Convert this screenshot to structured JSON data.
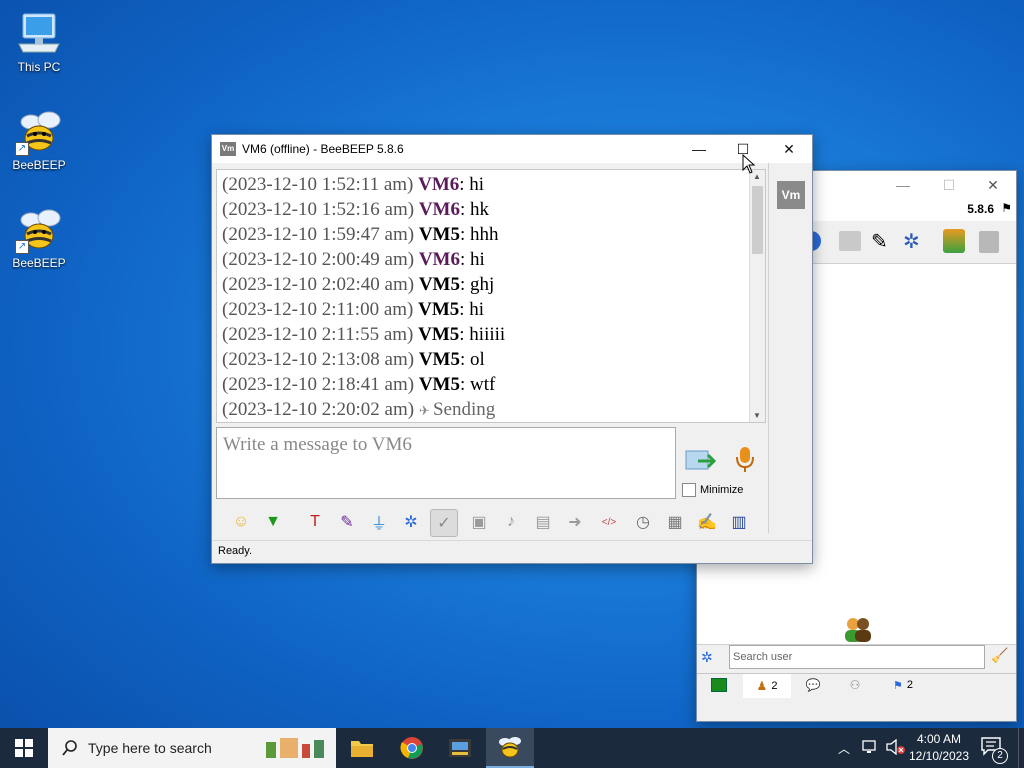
{
  "desktop": {
    "icons": [
      {
        "label": "This PC"
      },
      {
        "label": "BeeBEEP"
      },
      {
        "label": "BeeBEEP"
      }
    ]
  },
  "chat_window": {
    "icon_text": "Vm",
    "title": "VM6 (offline) - BeeBEEP 5.8.6",
    "messages": [
      {
        "ts": "(2023-12-10 1:52:11 am)",
        "user": "VM6",
        "text": ": hi"
      },
      {
        "ts": "(2023-12-10 1:52:16 am)",
        "user": "VM6",
        "text": ": hk"
      },
      {
        "ts": "(2023-12-10 1:59:47 am)",
        "user": "VM5",
        "text": ": hhh"
      },
      {
        "ts": "(2023-12-10 2:00:49 am)",
        "user": "VM6",
        "text": ": hi"
      },
      {
        "ts": "(2023-12-10 2:02:40 am)",
        "user": "VM5",
        "text": ": ghj"
      },
      {
        "ts": "(2023-12-10 2:11:00 am)",
        "user": "VM5",
        "text": ": hi"
      },
      {
        "ts": "(2023-12-10 2:11:55 am)",
        "user": "VM5",
        "text": ": hiiiii"
      },
      {
        "ts": "(2023-12-10 2:13:08 am)",
        "user": "VM5",
        "text": ": ol"
      },
      {
        "ts": "(2023-12-10 2:18:41 am)",
        "user": "VM5",
        "text": ": wtf"
      },
      {
        "ts": "(2023-12-10 2:20:02 am)",
        "status": "Sending"
      }
    ],
    "input_placeholder": "Write a message to VM6",
    "minimize_label": "Minimize",
    "side_avatar": "Vm",
    "status": "Ready.",
    "toolbar_icons": [
      "smiley-icon",
      "green-down-icon",
      "font-icon",
      "color-icon",
      "filter-icon",
      "gear-icon",
      "spellcheck-icon",
      "dictionary-icon",
      "music-icon",
      "file-icon",
      "send-file-icon",
      "html-icon",
      "clock-icon",
      "screenshot-icon",
      "notes-icon",
      "save-icon"
    ]
  },
  "back_window": {
    "version": "5.8.6",
    "search_placeholder": "Search user",
    "tabs": [
      {
        "icon": "green-screen-icon",
        "count": ""
      },
      {
        "icon": "users-icon",
        "count": "2"
      },
      {
        "icon": "chat-icon",
        "count": ""
      },
      {
        "icon": "groups-icon",
        "count": ""
      },
      {
        "icon": "flag-icon",
        "count": "2"
      }
    ]
  },
  "taskbar": {
    "search_text": "Type here to search",
    "time": "4:00 AM",
    "date": "12/10/2023",
    "notification_count": "2"
  },
  "colors": {
    "vm6_name": "#5a1a5a",
    "taskbar": "#1b2a3c"
  }
}
